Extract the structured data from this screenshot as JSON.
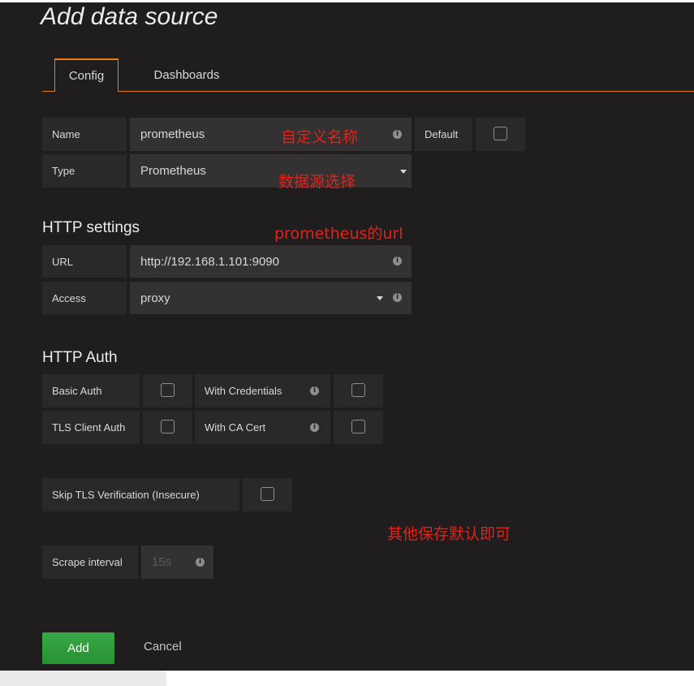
{
  "page": {
    "title": "Add data source"
  },
  "tabs": [
    {
      "label": "Config",
      "active": true
    },
    {
      "label": "Dashboards",
      "active": false
    }
  ],
  "basic": {
    "name_label": "Name",
    "name_value": "prometheus",
    "default_label": "Default",
    "default_checked": false,
    "type_label": "Type",
    "type_value": "Prometheus"
  },
  "http_settings": {
    "heading": "HTTP settings",
    "url_label": "URL",
    "url_value": "http://192.168.1.101:9090",
    "access_label": "Access",
    "access_value": "proxy"
  },
  "http_auth": {
    "heading": "HTTP Auth",
    "basic_auth_label": "Basic Auth",
    "with_credentials_label": "With Credentials",
    "tls_client_auth_label": "TLS Client Auth",
    "with_ca_cert_label": "With CA Cert",
    "basic_auth_checked": false,
    "with_credentials_checked": false,
    "tls_client_auth_checked": false,
    "with_ca_cert_checked": false
  },
  "tls": {
    "skip_label": "Skip TLS Verification (Insecure)",
    "skip_checked": false
  },
  "scrape": {
    "label": "Scrape interval",
    "placeholder": "15s"
  },
  "annotations": {
    "name_note": "自定义名称",
    "type_note": "数据源选择",
    "url_note": "prometheus的url",
    "other_note": "其他保存默认即可"
  },
  "actions": {
    "add_label": "Add",
    "cancel_label": "Cancel"
  },
  "colors": {
    "accent": "#eb7b18",
    "primary_button": "#2d9b3a",
    "annotation": "#e0231b",
    "background": "#1f1d1d"
  }
}
